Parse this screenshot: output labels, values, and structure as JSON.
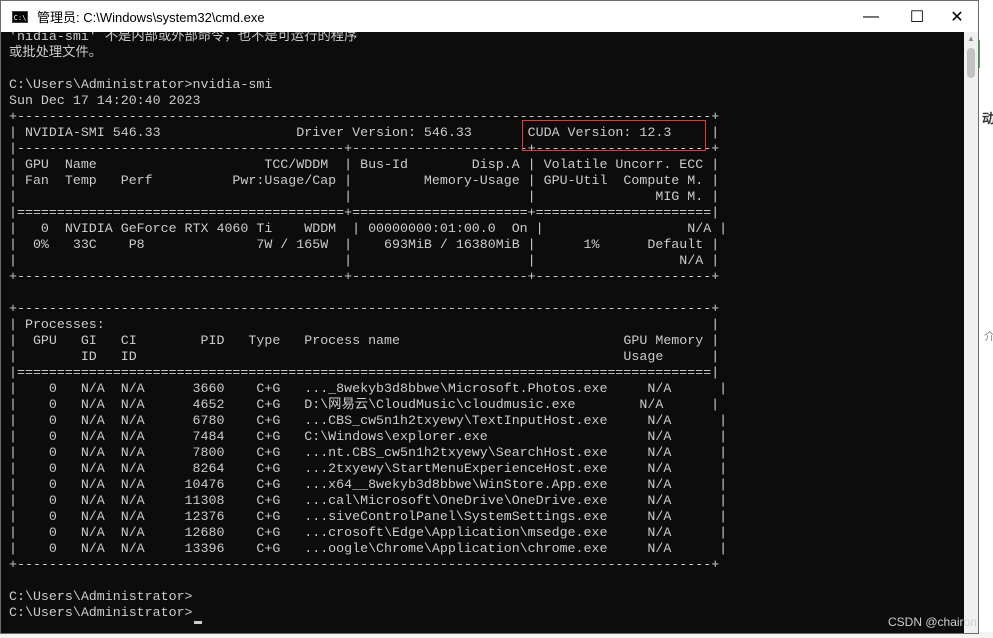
{
  "window": {
    "title": "管理员: C:\\Windows\\system32\\cmd.exe",
    "icon_text": "C:\\",
    "controls": {
      "minimize": "—",
      "maximize": "☐",
      "close": "✕"
    }
  },
  "console": {
    "lines": [
      "'nidia-smi' 不是内部或外部命令，也不是可运行的程序",
      "或批处理文件。",
      "",
      "C:\\Users\\Administrator>nvidia-smi",
      "Sun Dec 17 14:20:40 2023",
      "+---------------------------------------------------------------------------------------+",
      "| NVIDIA-SMI 546.33                 Driver Version: 546.33       CUDA Version: 12.3     |",
      "|-----------------------------------------+----------------------+----------------------+",
      "| GPU  Name                     TCC/WDDM  | Bus-Id        Disp.A | Volatile Uncorr. ECC |",
      "| Fan  Temp   Perf          Pwr:Usage/Cap |         Memory-Usage | GPU-Util  Compute M. |",
      "|                                         |                      |               MIG M. |",
      "|=========================================+======================+======================|",
      "|   0  NVIDIA GeForce RTX 4060 Ti    WDDM  | 00000000:01:00.0  On |                  N/A |",
      "|  0%   33C    P8              7W / 165W  |    693MiB / 16380MiB |      1%      Default |",
      "|                                         |                      |                  N/A |",
      "+-----------------------------------------+----------------------+----------------------+",
      "",
      "+---------------------------------------------------------------------------------------+",
      "| Processes:                                                                            |",
      "|  GPU   GI   CI        PID   Type   Process name                            GPU Memory |",
      "|        ID   ID                                                             Usage      |",
      "|=======================================================================================|",
      "|    0   N/A  N/A      3660    C+G   ..._8wekyb3d8bbwe\\Microsoft.Photos.exe     N/A      |",
      "|    0   N/A  N/A      4652    C+G   D:\\网易云\\CloudMusic\\cloudmusic.exe        N/A      |",
      "|    0   N/A  N/A      6780    C+G   ...CBS_cw5n1h2txyewy\\TextInputHost.exe     N/A      |",
      "|    0   N/A  N/A      7484    C+G   C:\\Windows\\explorer.exe                    N/A      |",
      "|    0   N/A  N/A      7800    C+G   ...nt.CBS_cw5n1h2txyewy\\SearchHost.exe     N/A      |",
      "|    0   N/A  N/A      8264    C+G   ...2txyewy\\StartMenuExperienceHost.exe     N/A      |",
      "|    0   N/A  N/A     10476    C+G   ...x64__8wekyb3d8bbwe\\WinStore.App.exe     N/A      |",
      "|    0   N/A  N/A     11308    C+G   ...cal\\Microsoft\\OneDrive\\OneDrive.exe     N/A      |",
      "|    0   N/A  N/A     12376    C+G   ...siveControlPanel\\SystemSettings.exe     N/A      |",
      "|    0   N/A  N/A     12680    C+G   ...crosoft\\Edge\\Application\\msedge.exe     N/A      |",
      "|    0   N/A  N/A     13396    C+G   ...oogle\\Chrome\\Application\\chrome.exe     N/A      |",
      "+---------------------------------------------------------------------------------------+",
      "",
      "C:\\Users\\Administrator>",
      "C:\\Users\\Administrator>"
    ]
  },
  "background": {
    "fragment_1": "动",
    "fragment_2": "介"
  },
  "watermark": "CSDN @chairon",
  "colors": {
    "console_bg": "#0c0c0c",
    "console_fg": "#cccccc",
    "highlight": "#e53935"
  }
}
